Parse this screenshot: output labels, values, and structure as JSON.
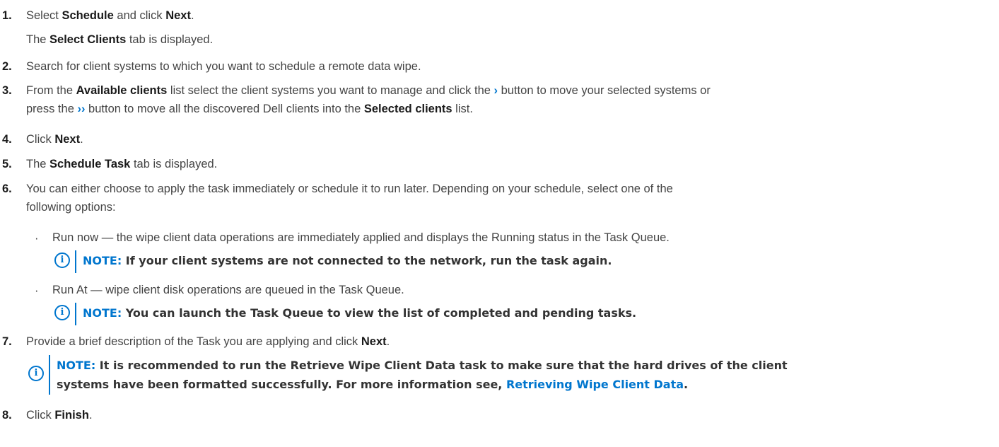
{
  "steps": [
    {
      "num": "1.",
      "pre": "Select ",
      "b1": "Schedule",
      "mid": " and click ",
      "b2": "Next",
      "post": "."
    },
    {
      "sub_pre": "The ",
      "sub_b": "Select Clients",
      "sub_post": " tab is displayed."
    },
    {
      "num": "2.",
      "text": "Search for client systems to which you want to schedule a remote data wipe."
    },
    {
      "num": "3.",
      "pre": "From the ",
      "b1": "Available clients",
      "mid1": " list select the client systems you want to manage and click the ",
      "chev1": "›",
      "mid2": " button to move your selected systems or",
      "line2_pre": "press the ",
      "chev2": "››",
      "line2_mid": " button to move all the discovered Dell clients into the ",
      "b2": "Selected clients",
      "line2_post": " list."
    },
    {
      "num": "4.",
      "pre": "Click ",
      "b": "Next",
      "post": "."
    },
    {
      "num": "5.",
      "pre": "The ",
      "b": "Schedule Task",
      "post": " tab is displayed."
    },
    {
      "num": "6.",
      "line1": "You can either choose to apply the task immediately or schedule it to run later. Depending on your schedule, select one of the",
      "line2": "following options:"
    },
    {
      "num": "7.",
      "pre": "Provide a brief description of the Task you are applying and click ",
      "b": "Next",
      "post": "."
    },
    {
      "num": "8.",
      "pre": "Click ",
      "b": "Finish",
      "post": "."
    }
  ],
  "bullets": [
    {
      "text": "Run now — the wipe client data operations are immediately applied and displays the Running status in the Task Queue."
    },
    {
      "text": "Run At — wipe client disk operations are queued in the Task Queue."
    }
  ],
  "notes": {
    "icon_glyph": "i",
    "label": "NOTE:",
    "note1": " If your client systems are not connected to the network, run the task again.",
    "note2": " You can launch the Task Queue to view the list of completed and pending tasks.",
    "note3_line1": " It is recommended to run the Retrieve Wipe Client Data task to make sure that the hard drives of the client",
    "note3_line2_pre": "systems have been formatted successfully. For more information see, ",
    "note3_link": "Retrieving Wipe Client Data",
    "note3_line2_post": "."
  },
  "colors": {
    "accent": "#0076ce",
    "text": "#444444",
    "bold": "#1a1a1a"
  },
  "icons": [
    "chevron-right-icon",
    "double-chevron-right-icon",
    "info-icon"
  ]
}
